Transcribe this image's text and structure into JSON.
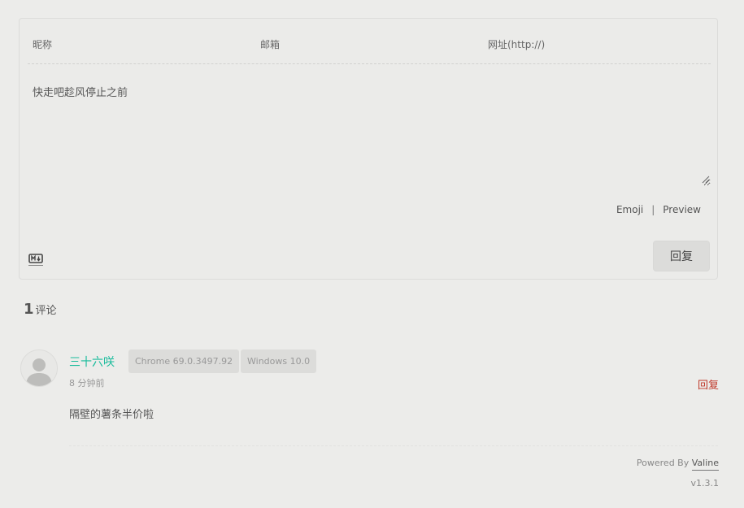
{
  "form": {
    "nick_placeholder": "昵称",
    "mail_placeholder": "邮箱",
    "link_placeholder": "网址(http://)",
    "comment_value": "快走吧趁风停止之前",
    "emoji_label": "Emoji",
    "separator": "|",
    "preview_label": "Preview",
    "submit_label": "回复"
  },
  "comments": {
    "count": "1",
    "count_label": "评论",
    "items": [
      {
        "nick": "三十六咲",
        "browser": "Chrome 69.0.3497.92",
        "os": "Windows 10.0",
        "time": "8 分钟前",
        "reply_label": "回复",
        "content": "隔壁的薯条半价啦"
      }
    ]
  },
  "footer": {
    "powered_by": "Powered By",
    "brand": "Valine",
    "version": "v1.3.1"
  },
  "colors": {
    "accent": "#1abc9c",
    "reply": "#c0392b",
    "background": "#ececea"
  }
}
